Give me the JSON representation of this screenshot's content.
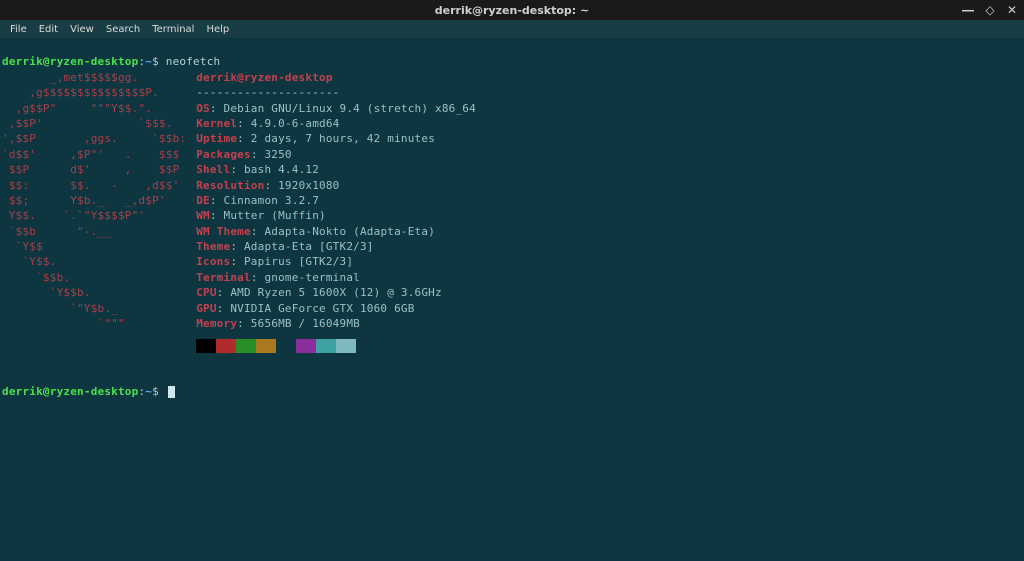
{
  "window": {
    "title": "derrik@ryzen-desktop: ~"
  },
  "menu": {
    "file": "File",
    "edit": "Edit",
    "view": "View",
    "search": "Search",
    "terminal": "Terminal",
    "help": "Help"
  },
  "prompt": {
    "userhost": "derrik@ryzen-desktop",
    "colon": ":",
    "path": "~",
    "dollar": "$",
    "command": "neofetch"
  },
  "ascii": "       _,met$$$$$gg.\n    ,g$$$$$$$$$$$$$$$P.\n  ,g$$P\"     \"\"\"Y$$.\".\n ,$$P'              `$$$.\n',$$P       ,ggs.     `$$b:\n`d$$'     ,$P\"'   .    $$$\n $$P      d$'     ,    $$P\n $$:      $$.   -    ,d$$'\n $$;      Y$b._   _,d$P'\n Y$$.    `.`\"Y$$$$P\"'\n `$$b      \"-.__\n  `Y$$\n   `Y$$.\n     `$$b.\n       `Y$$b.\n          `\"Y$b._\n              `\"\"\"",
  "info": {
    "title": "derrik@ryzen-desktop",
    "dashes": "---------------------",
    "lines": [
      {
        "key": "OS",
        "value": "Debian GNU/Linux 9.4 (stretch) x86_64"
      },
      {
        "key": "Kernel",
        "value": "4.9.0-6-amd64"
      },
      {
        "key": "Uptime",
        "value": "2 days, 7 hours, 42 minutes"
      },
      {
        "key": "Packages",
        "value": "3250"
      },
      {
        "key": "Shell",
        "value": "bash 4.4.12"
      },
      {
        "key": "Resolution",
        "value": "1920x1080"
      },
      {
        "key": "DE",
        "value": "Cinnamon 3.2.7"
      },
      {
        "key": "WM",
        "value": "Mutter (Muffin)"
      },
      {
        "key": "WM Theme",
        "value": "Adapta-Nokto (Adapta-Eta)"
      },
      {
        "key": "Theme",
        "value": "Adapta-Eta [GTK2/3]"
      },
      {
        "key": "Icons",
        "value": "Papirus [GTK2/3]"
      },
      {
        "key": "Terminal",
        "value": "gnome-terminal"
      },
      {
        "key": "CPU",
        "value": "AMD Ryzen 5 1600X (12) @ 3.6GHz"
      },
      {
        "key": "GPU",
        "value": "NVIDIA GeForce GTX 1060 6GB"
      },
      {
        "key": "Memory",
        "value": "5656MB / 16049MB"
      }
    ]
  },
  "swatches": [
    "#000000",
    "#b02c2c",
    "#288e28",
    "#aa7a20",
    "#0d3640",
    "#8a2f9c",
    "#3ea2a5",
    "#7fb8be"
  ]
}
